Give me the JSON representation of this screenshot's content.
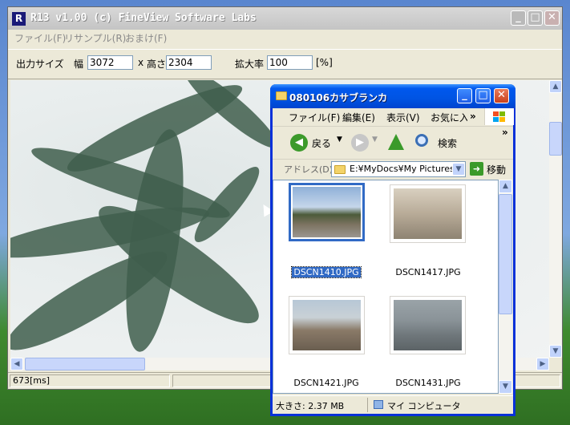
{
  "main_window": {
    "title": "R13 v1.00 (c) FineView Software Labs",
    "logo_text": "R",
    "controls": {
      "minimize": "_",
      "maximize": "□",
      "close": "✕"
    },
    "menu": [
      "ファイル(F)",
      "リサンプル(R)",
      "おまけ(F)"
    ],
    "toolbar": {
      "output_size_label": "出力サイズ",
      "width_label": "幅",
      "width_value": "3072",
      "x_label": "x",
      "height_label": "高さ",
      "height_value": "2304",
      "zoom_label": "拡大率",
      "zoom_value": "100",
      "percent_label": "[%]"
    },
    "status": {
      "time": "673[ms]"
    }
  },
  "explorer": {
    "title": "080106カサブランカ",
    "menu": [
      "ファイル(F)",
      "編集(E)",
      "表示(V)",
      "お気に入",
      "»"
    ],
    "toolbar": {
      "back": "戻る",
      "search": "検索",
      "more": "»"
    },
    "address": {
      "label": "アドレス(D)",
      "value": "E:¥MyDocs¥My Pictures¥",
      "go": "移動"
    },
    "files": [
      {
        "name": "DSCN1410.JPG",
        "selected": true
      },
      {
        "name": "DSCN1417.JPG",
        "selected": false
      },
      {
        "name": "DSCN1421.JPG",
        "selected": false
      },
      {
        "name": "DSCN1431.JPG",
        "selected": false
      }
    ],
    "status": {
      "size": "大きさ: 2.37 MB",
      "location": "マイ コンピュータ"
    }
  }
}
